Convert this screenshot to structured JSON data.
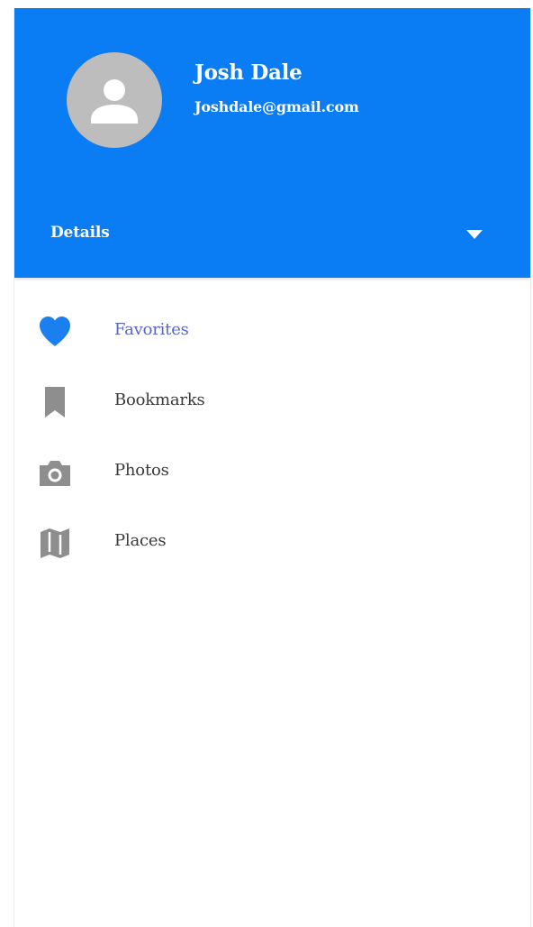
{
  "profile": {
    "name": "Josh Dale",
    "email": "Joshdale@gmail.com"
  },
  "header": {
    "details_label": "Details",
    "details_icon": "caret-down-icon"
  },
  "menu": {
    "items": [
      {
        "label": "Favorites",
        "icon": "heart-icon",
        "active": true
      },
      {
        "label": "Bookmarks",
        "icon": "bookmark-icon",
        "active": false
      },
      {
        "label": "Photos",
        "icon": "camera-icon",
        "active": false
      },
      {
        "label": "Places",
        "icon": "map-icon",
        "active": false
      }
    ]
  },
  "colors": {
    "header_bg": "#0a7cf4",
    "active_icon": "#1a80f0",
    "active_label": "#5a66c9",
    "inactive_icon": "#8e8e8e",
    "avatar_bg": "#bdbdbd"
  }
}
